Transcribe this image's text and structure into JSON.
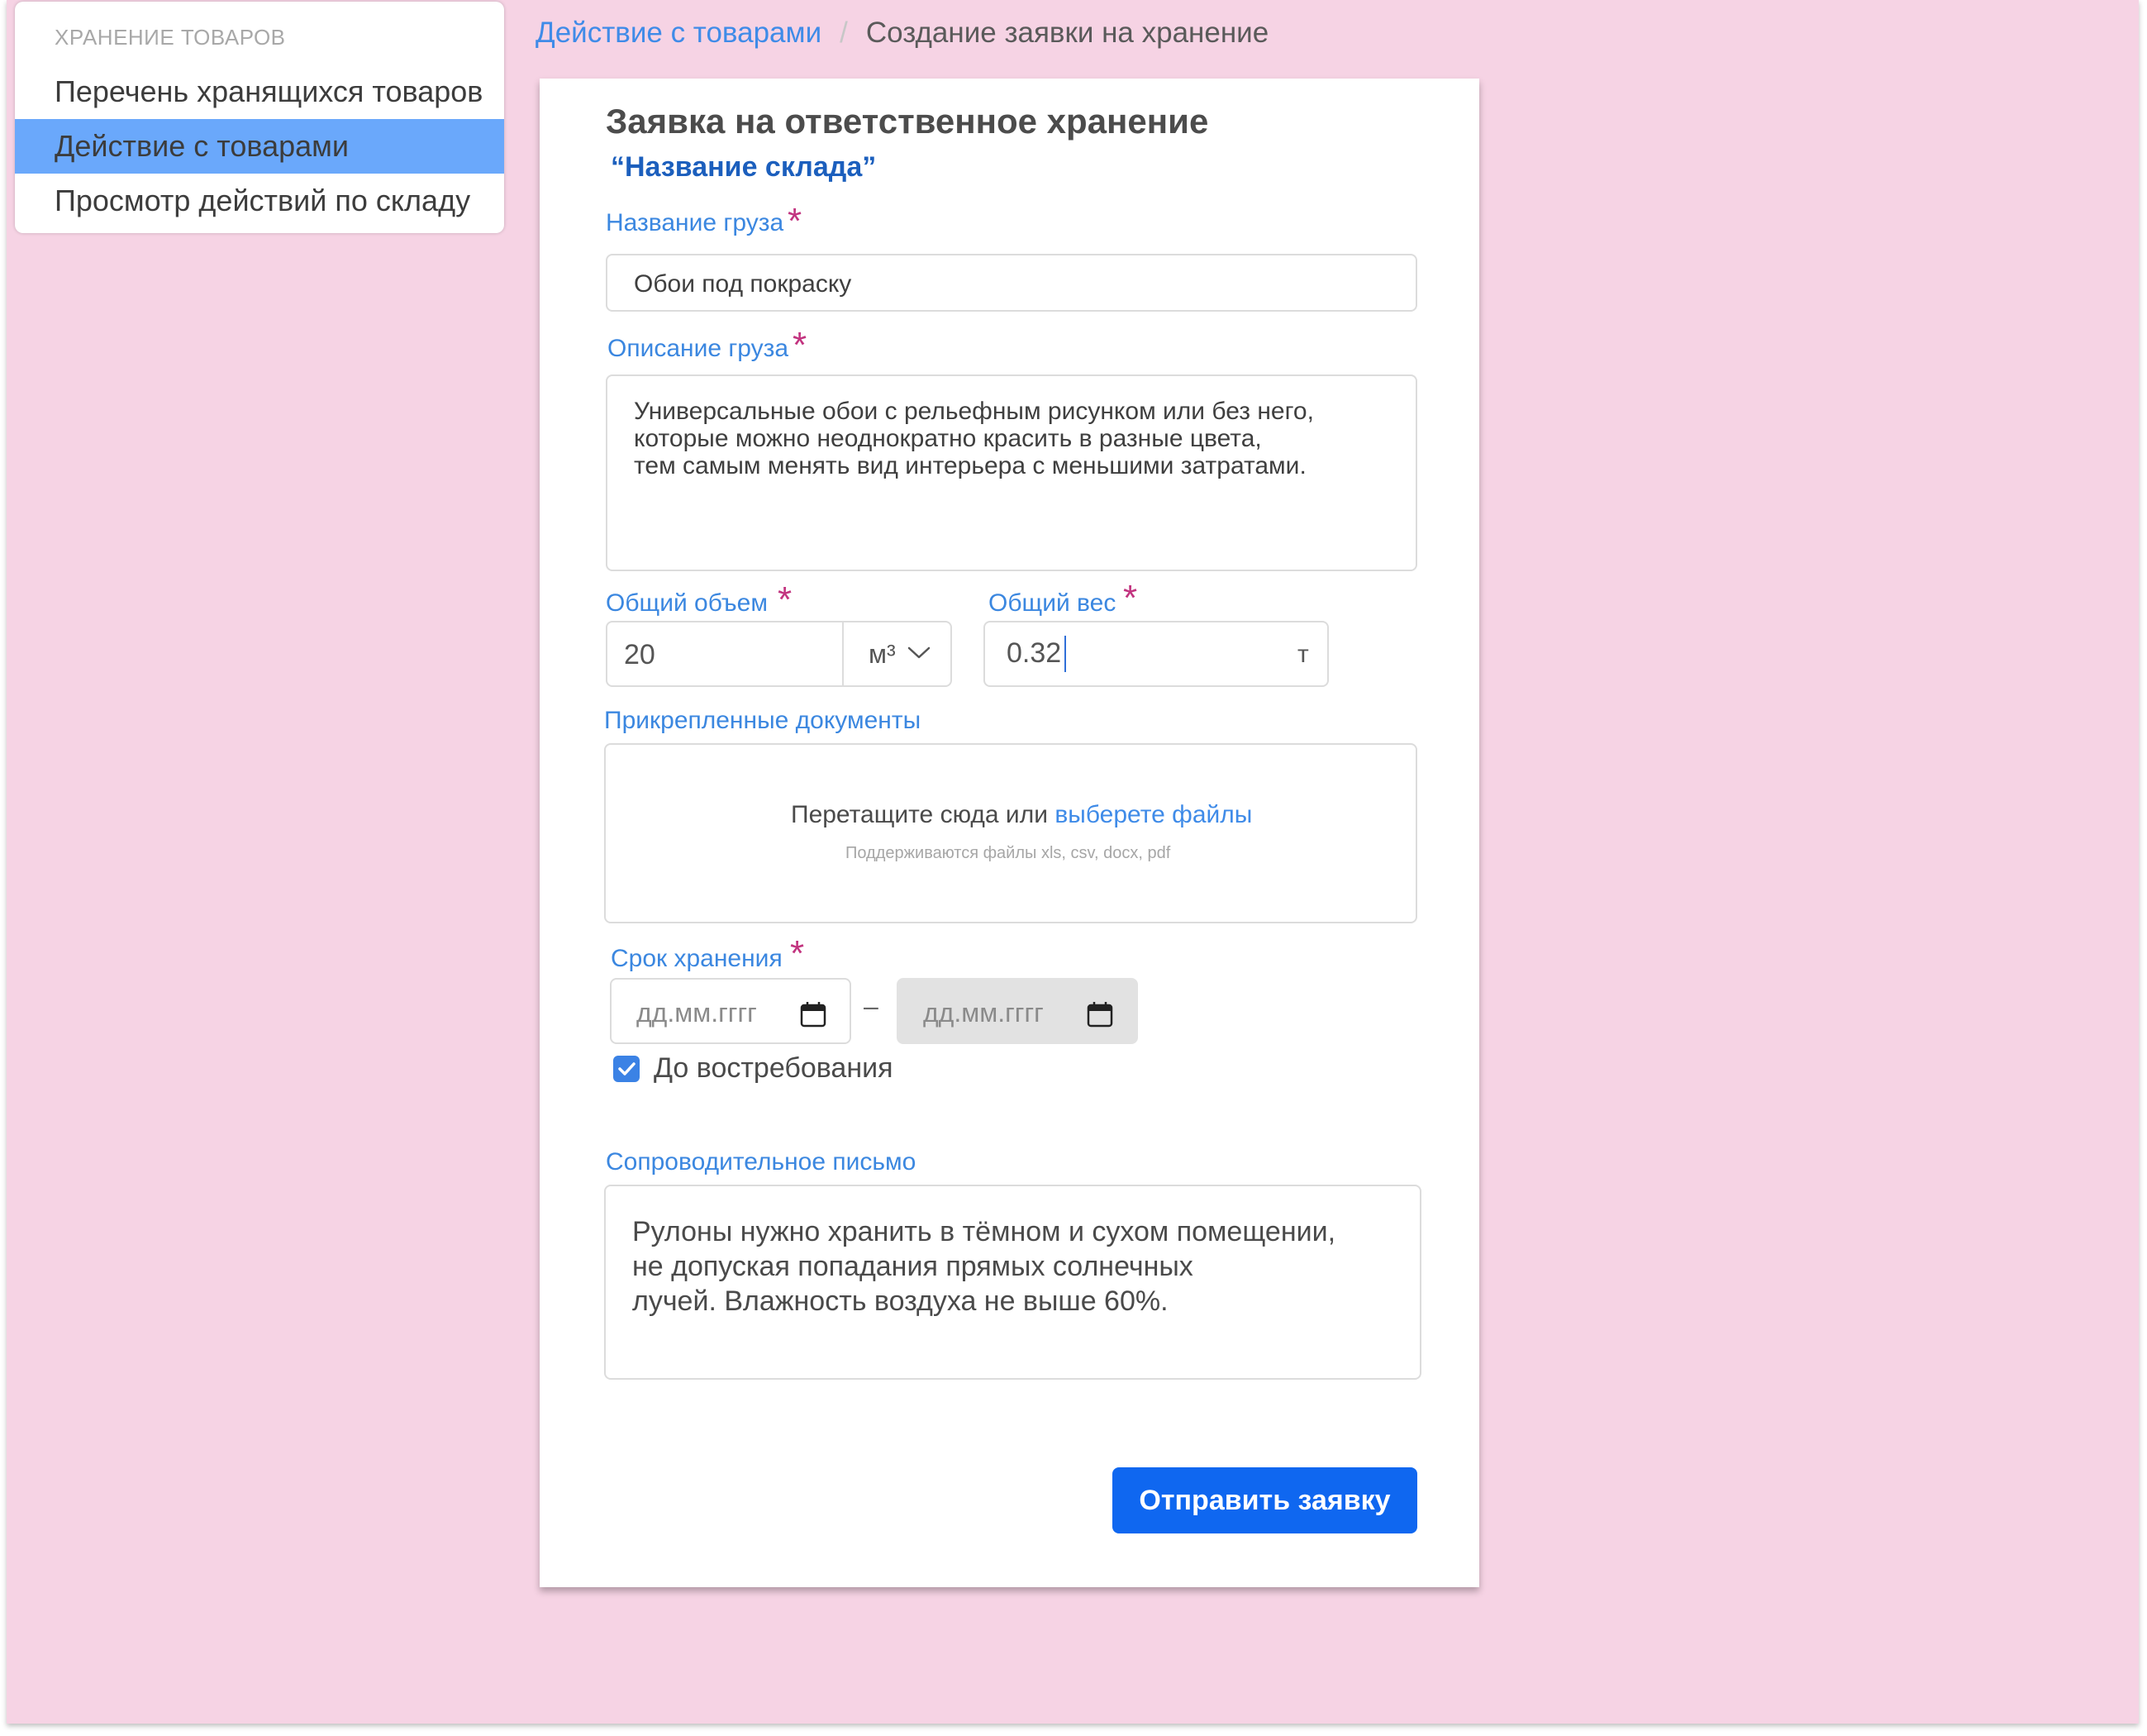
{
  "sidebar": {
    "section_title": "ХРАНЕНИЕ ТОВАРОВ",
    "items": [
      {
        "label": "Перечень хранящихся товаров",
        "active": false
      },
      {
        "label": "Действие с товарами",
        "active": true
      },
      {
        "label": "Просмотр действий по складу",
        "active": false
      }
    ]
  },
  "breadcrumb": {
    "parent": "Действие с товарами",
    "separator": "/",
    "current": "Создание заявки на хранение"
  },
  "form": {
    "title": "Заявка на ответственное хранение",
    "warehouse_name": "“Название склада”",
    "cargo_name": {
      "label": "Название груза",
      "required_mark": "*",
      "value": "Обои под покраску"
    },
    "cargo_description": {
      "label": "Описание груза",
      "required_mark": "*",
      "value": "Универсальные обои с рельефным рисунком или без него,\nкоторые можно неоднократно красить в разные цвета,\nтем самым менять вид интерьера с меньшими затратами."
    },
    "volume": {
      "label": "Общий объем",
      "required_mark": "*",
      "value": "20",
      "unit": "м³",
      "unit_icon": "chevron-down-icon"
    },
    "weight": {
      "label": "Общий вес",
      "required_mark": "*",
      "value": "0.32",
      "unit": "т"
    },
    "documents": {
      "label": "Прикрепленные документы",
      "drop_text": "Перетащите сюда или",
      "select_link": "выберете файлы",
      "hint": "Поддерживаются файлы xls, csv, docx, pdf"
    },
    "storage_period": {
      "label": "Срок хранения",
      "required_mark": "*",
      "start_placeholder": "дд.мм.гггг",
      "dash": "–",
      "end_placeholder": "дд.мм.гггг",
      "calendar_icon": "calendar-icon",
      "until_demand": {
        "label": "До востребования",
        "checked": true
      }
    },
    "cover_letter": {
      "label": "Сопроводительное письмо",
      "value": "Рулоны нужно хранить в тёмном и сухом помещении,\nне допуская попадания прямых солнечных\nлучей. Влажность воздуха не выше 60%."
    },
    "submit_label": "Отправить заявку"
  },
  "colors": {
    "background": "#f6d3e4",
    "accent": "#3f8be8",
    "sidebar_active": "#6aa8fb",
    "required": "#c2337f",
    "button": "#0f67f0"
  }
}
